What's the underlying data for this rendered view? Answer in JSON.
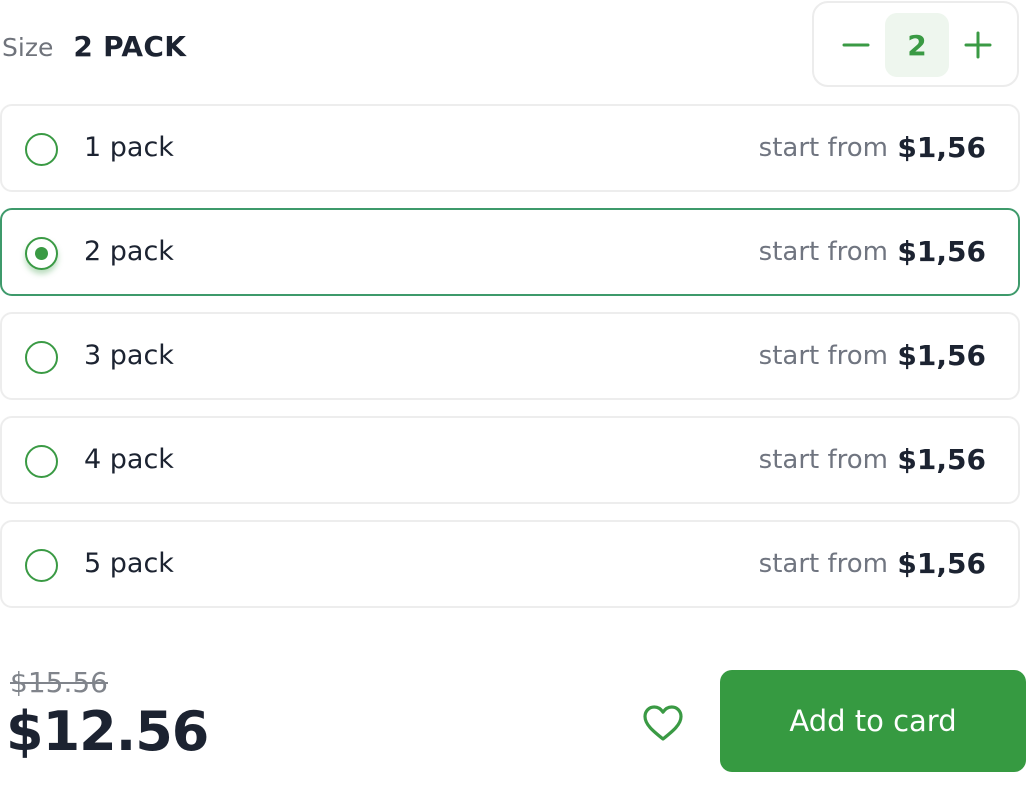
{
  "header": {
    "size_label": "Size",
    "size_value": "2 PACK"
  },
  "stepper": {
    "quantity": "2",
    "decrement_icon": "minus-icon",
    "increment_icon": "plus-icon"
  },
  "options": [
    {
      "label": "1 pack",
      "start_text": "start from",
      "price": "$1,56",
      "selected": false
    },
    {
      "label": "2 pack",
      "start_text": "start from",
      "price": "$1,56",
      "selected": true
    },
    {
      "label": "3 pack",
      "start_text": "start from",
      "price": "$1,56",
      "selected": false
    },
    {
      "label": "4 pack",
      "start_text": "start from",
      "price": "$1,56",
      "selected": false
    },
    {
      "label": "5 pack",
      "start_text": "start from",
      "price": "$1,56",
      "selected": false
    }
  ],
  "footer": {
    "old_price": "$15.56",
    "new_price": "$12.56",
    "favorite_icon": "heart-icon",
    "add_button_label": "Add to card"
  },
  "colors": {
    "accent": "#3a9a44",
    "button_bg": "#369a41",
    "selected_border": "#3e9a6b",
    "text_dark": "#1c2331",
    "text_muted": "#707580"
  }
}
